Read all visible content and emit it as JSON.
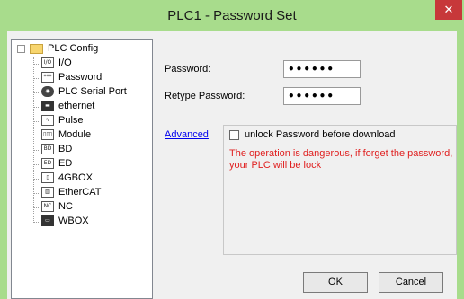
{
  "window": {
    "title": "PLC1 - Password  Set",
    "close_glyph": "✕",
    "titlebar_color": "#a8dc8c",
    "close_color": "#c7383a"
  },
  "tree": {
    "root": {
      "label": "PLC Config",
      "expander": "−",
      "icon": "folder-icon"
    },
    "items": [
      {
        "label": "I/O",
        "icon_text": "I/O",
        "icon": "io-icon"
      },
      {
        "label": "Password",
        "icon_text": "***",
        "icon": "password-icon"
      },
      {
        "label": "PLC Serial Port",
        "icon_text": "◉",
        "icon": "serial-port-icon"
      },
      {
        "label": "ethernet",
        "icon_text": "▬",
        "icon": "ethernet-icon"
      },
      {
        "label": "Pulse",
        "icon_text": "∿",
        "icon": "pulse-icon"
      },
      {
        "label": "Module",
        "icon_text": "▯▯▯",
        "icon": "module-icon"
      },
      {
        "label": "BD",
        "icon_text": "BD",
        "icon": "bd-icon"
      },
      {
        "label": "ED",
        "icon_text": "ED",
        "icon": "ed-icon"
      },
      {
        "label": "4GBOX",
        "icon_text": "▯",
        "icon": "4gbox-icon"
      },
      {
        "label": "EtherCAT",
        "icon_text": "▥",
        "icon": "ethercat-icon"
      },
      {
        "label": "NC",
        "icon_text": "NC",
        "icon": "nc-icon"
      },
      {
        "label": "WBOX",
        "icon_text": "▭",
        "icon": "wbox-icon"
      }
    ]
  },
  "form": {
    "password_label": "Password:",
    "password_value": "••••••",
    "retype_label": "Retype Password:",
    "retype_value": "••••••"
  },
  "advanced": {
    "link_label": "Advanced",
    "checkbox_label": "unlock Password before download",
    "checkbox_checked": false,
    "warning": "The operation is dangerous, if forget the password, your PLC will be lock",
    "warning_color": "#e02020"
  },
  "buttons": {
    "ok": "OK",
    "cancel": "Cancel"
  }
}
